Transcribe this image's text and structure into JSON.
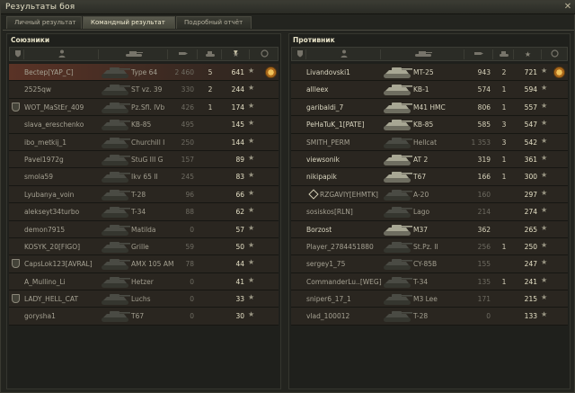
{
  "window": {
    "title": "Результаты боя",
    "close_glyph": "✕"
  },
  "tabs": [
    {
      "label": "Личный результат",
      "active": false
    },
    {
      "label": "Командный результат",
      "active": true
    },
    {
      "label": "Подробный отчёт",
      "active": false
    }
  ],
  "allies": {
    "title": "Союзники",
    "rows": [
      {
        "name": "Bectep[YAP_C]",
        "tank": "Type 64",
        "damage": "2 460",
        "frags": "5",
        "xp": "641",
        "alive": false,
        "mine": true,
        "clan": false,
        "medal": true
      },
      {
        "name": "2525qw",
        "tank": "ST vz. 39",
        "damage": "330",
        "frags": "2",
        "xp": "244",
        "alive": false,
        "mine": false,
        "clan": false,
        "medal": false
      },
      {
        "name": "WOT_MaStEr_409",
        "tank": "Pz.Sfl. IVb",
        "damage": "426",
        "frags": "1",
        "xp": "174",
        "alive": false,
        "mine": false,
        "clan": true,
        "medal": false
      },
      {
        "name": "slava_ereschenko",
        "tank": "KB-85",
        "damage": "495",
        "frags": "",
        "xp": "145",
        "alive": false,
        "mine": false,
        "clan": false,
        "medal": false
      },
      {
        "name": "ibo_metkij_1",
        "tank": "Churchill I",
        "damage": "250",
        "frags": "",
        "xp": "144",
        "alive": false,
        "mine": false,
        "clan": false,
        "medal": false
      },
      {
        "name": "Pavel1972g",
        "tank": "StuG III G",
        "damage": "157",
        "frags": "",
        "xp": "89",
        "alive": false,
        "mine": false,
        "clan": false,
        "medal": false
      },
      {
        "name": "smola59",
        "tank": "Ikv 65 II",
        "damage": "245",
        "frags": "",
        "xp": "83",
        "alive": false,
        "mine": false,
        "clan": false,
        "medal": false
      },
      {
        "name": "Lyubanya_voin",
        "tank": "T-28",
        "damage": "96",
        "frags": "",
        "xp": "66",
        "alive": false,
        "mine": false,
        "clan": false,
        "medal": false
      },
      {
        "name": "alekseyt34turbo",
        "tank": "T-34",
        "damage": "88",
        "frags": "",
        "xp": "62",
        "alive": false,
        "mine": false,
        "clan": false,
        "medal": false
      },
      {
        "name": "demon7915",
        "tank": "Matilda",
        "damage": "0",
        "frags": "",
        "xp": "57",
        "alive": false,
        "mine": false,
        "clan": false,
        "medal": false
      },
      {
        "name": "KOSYK_20[FIGO]",
        "tank": "Grille",
        "damage": "59",
        "frags": "",
        "xp": "50",
        "alive": false,
        "mine": false,
        "clan": false,
        "medal": false
      },
      {
        "name": "CapsLok123[AVRAL]",
        "tank": "AMX 105 AM",
        "damage": "78",
        "frags": "",
        "xp": "44",
        "alive": false,
        "mine": false,
        "clan": true,
        "medal": false
      },
      {
        "name": "A_Mullino_Li",
        "tank": "Hetzer",
        "damage": "0",
        "frags": "",
        "xp": "41",
        "alive": false,
        "mine": false,
        "clan": false,
        "medal": false
      },
      {
        "name": "LADY_HELL_CAT",
        "tank": "Luchs",
        "damage": "0",
        "frags": "",
        "xp": "33",
        "alive": false,
        "mine": false,
        "clan": true,
        "medal": false
      },
      {
        "name": "gorysha1",
        "tank": "T67",
        "damage": "0",
        "frags": "",
        "xp": "30",
        "alive": false,
        "mine": false,
        "clan": false,
        "medal": false
      }
    ]
  },
  "enemies": {
    "title": "Противник",
    "rows": [
      {
        "name": "Livandovski1",
        "tank": "MT-25",
        "damage": "943",
        "frags": "2",
        "xp": "721",
        "alive": true,
        "command": false,
        "medal": true
      },
      {
        "name": "allleex",
        "tank": "KB-1",
        "damage": "574",
        "frags": "1",
        "xp": "594",
        "alive": true,
        "command": false,
        "medal": false
      },
      {
        "name": "garibaldi_7",
        "tank": "M41 HMC",
        "damage": "806",
        "frags": "1",
        "xp": "557",
        "alive": true,
        "command": false,
        "medal": false
      },
      {
        "name": "PeHaTuK_1[PATE]",
        "tank": "KB-85",
        "damage": "585",
        "frags": "3",
        "xp": "547",
        "alive": true,
        "command": false,
        "medal": false
      },
      {
        "name": "SMITH_PERM",
        "tank": "Hellcat",
        "damage": "1 353",
        "frags": "3",
        "xp": "542",
        "alive": false,
        "command": false,
        "medal": false
      },
      {
        "name": "viewsonik",
        "tank": "AT 2",
        "damage": "319",
        "frags": "1",
        "xp": "361",
        "alive": true,
        "command": false,
        "medal": false
      },
      {
        "name": "nikipapik",
        "tank": "T67",
        "damage": "166",
        "frags": "1",
        "xp": "300",
        "alive": true,
        "command": false,
        "medal": false
      },
      {
        "name": "RZGAVIY[EHMTK]",
        "tank": "A-20",
        "damage": "160",
        "frags": "",
        "xp": "297",
        "alive": false,
        "command": true,
        "medal": false
      },
      {
        "name": "sosiskos[RLN]",
        "tank": "Lago",
        "damage": "214",
        "frags": "",
        "xp": "274",
        "alive": false,
        "command": false,
        "medal": false
      },
      {
        "name": "Borzost",
        "tank": "M37",
        "damage": "362",
        "frags": "",
        "xp": "265",
        "alive": true,
        "command": false,
        "medal": false
      },
      {
        "name": "Player_2784451880",
        "tank": "St.Pz. II",
        "damage": "256",
        "frags": "1",
        "xp": "250",
        "alive": false,
        "command": false,
        "medal": false
      },
      {
        "name": "sergey1_75",
        "tank": "CY-85B",
        "damage": "155",
        "frags": "",
        "xp": "247",
        "alive": false,
        "command": false,
        "medal": false
      },
      {
        "name": "CommanderLu..[WEG]",
        "tank": "T-34",
        "damage": "135",
        "frags": "1",
        "xp": "241",
        "alive": false,
        "command": false,
        "medal": false
      },
      {
        "name": "sniper6_17_1",
        "tank": "M3 Lee",
        "damage": "171",
        "frags": "",
        "xp": "215",
        "alive": false,
        "command": false,
        "medal": false
      },
      {
        "name": "vlad_100012",
        "tank": "T-28",
        "damage": "0",
        "frags": "",
        "xp": "133",
        "alive": false,
        "command": false,
        "medal": false
      }
    ]
  },
  "icons": {
    "star": "★",
    "sort": "▼",
    "clan": "shield-icon",
    "medal": "medal-icon"
  }
}
